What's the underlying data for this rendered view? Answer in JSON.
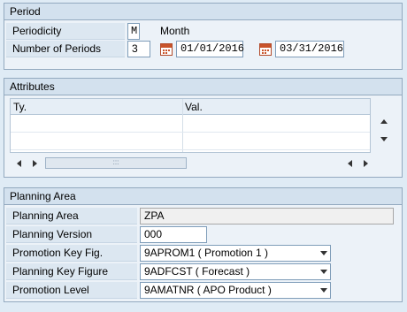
{
  "period": {
    "title": "Period",
    "periodicity_label": "Periodicity",
    "periodicity_value": "M",
    "periodicity_text": "Month",
    "num_periods_label": "Number of Periods",
    "num_periods_value": "3",
    "date_from": "01/01/2016",
    "date_to": "03/31/2016"
  },
  "attributes": {
    "title": "Attributes",
    "columns": [
      "Ty.",
      "Val."
    ],
    "scroll_thumb_glyph": ":::"
  },
  "planning_area": {
    "title": "Planning Area",
    "fields": [
      {
        "label": "Planning Area",
        "value": "ZPA"
      },
      {
        "label": "Planning Version",
        "value": "000"
      },
      {
        "label": "Promotion Key Fig.",
        "value": "9APROM1 ( Promotion 1 )"
      },
      {
        "label": "Planning Key Figure",
        "value": "9ADFCST ( Forecast )"
      },
      {
        "label": "Promotion Level",
        "value": "9AMATNR ( APO Product )"
      }
    ]
  },
  "icons": {
    "calendar": "calendar-icon",
    "table_settings": "table-settings-icon",
    "dropdown": "chevron-down-icon"
  },
  "colors": {
    "background": "#dfebf5",
    "group_header": "#d3e1ee",
    "border": "#93a9bf",
    "calendar_accent": "#c9542b"
  }
}
